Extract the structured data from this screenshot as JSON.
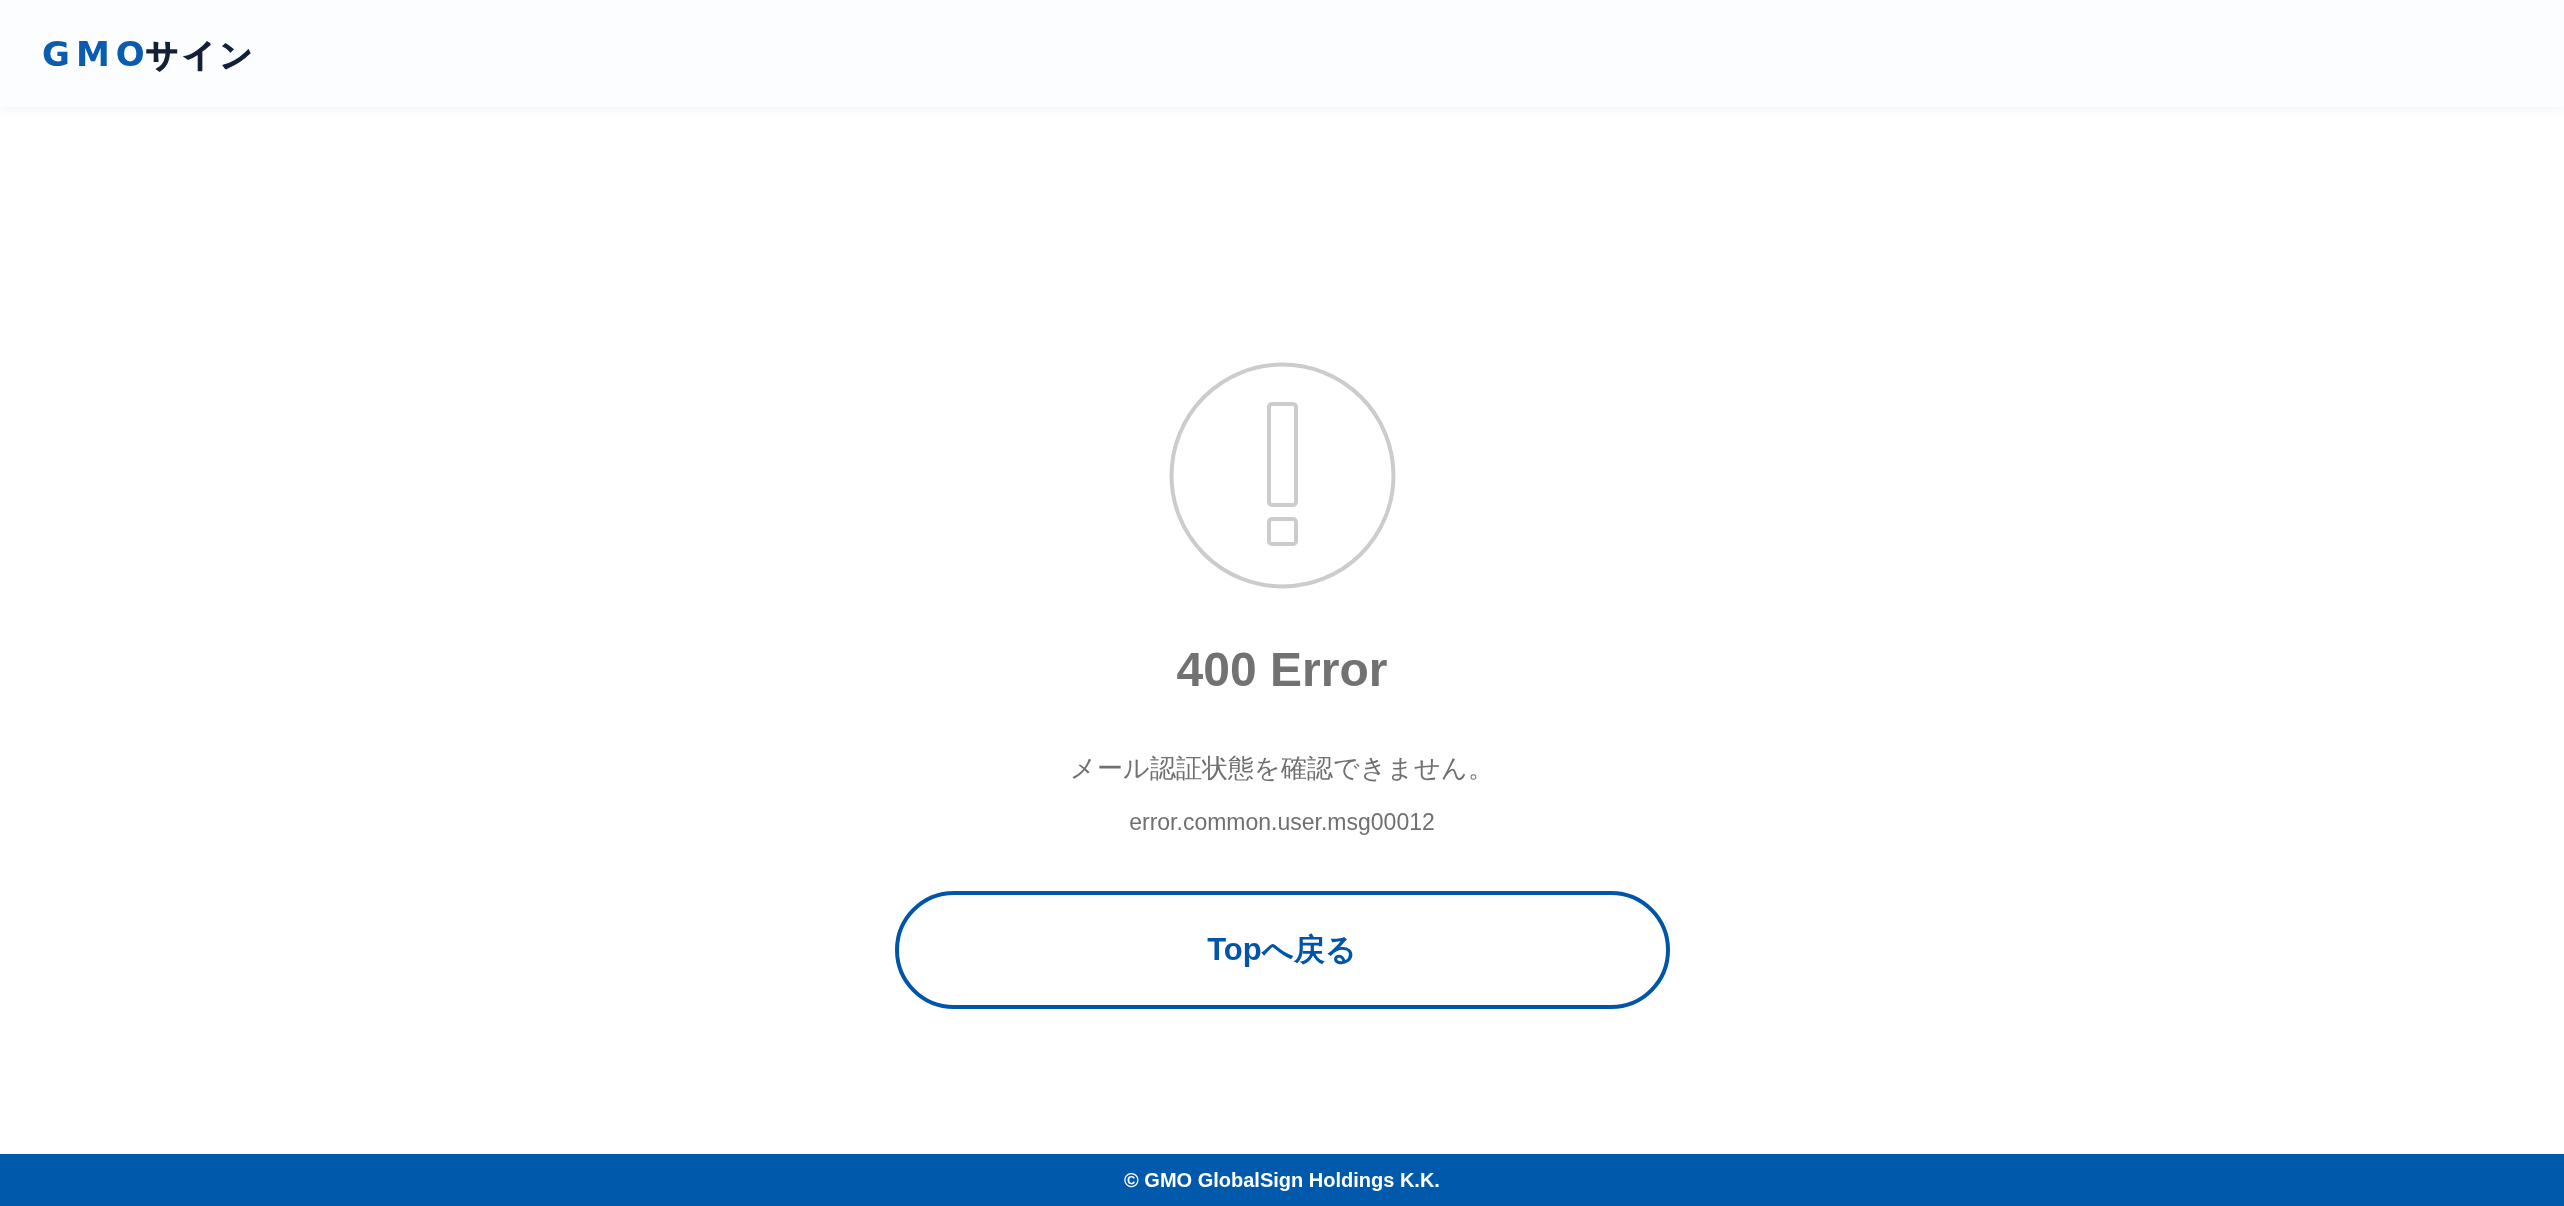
{
  "header": {
    "logo": [
      {
        "text": "GMO",
        "color": "#0a5cb0"
      },
      {
        "text": "サイン",
        "color": "#14203a"
      }
    ]
  },
  "error": {
    "title": "400 Error",
    "message": "メール認証状態を確認できません。",
    "code": "error.common.user.msg00012"
  },
  "button": {
    "label": "Topへ戻る"
  },
  "footer": {
    "copyright": "© GMO GlobalSign Holdings K.K."
  }
}
